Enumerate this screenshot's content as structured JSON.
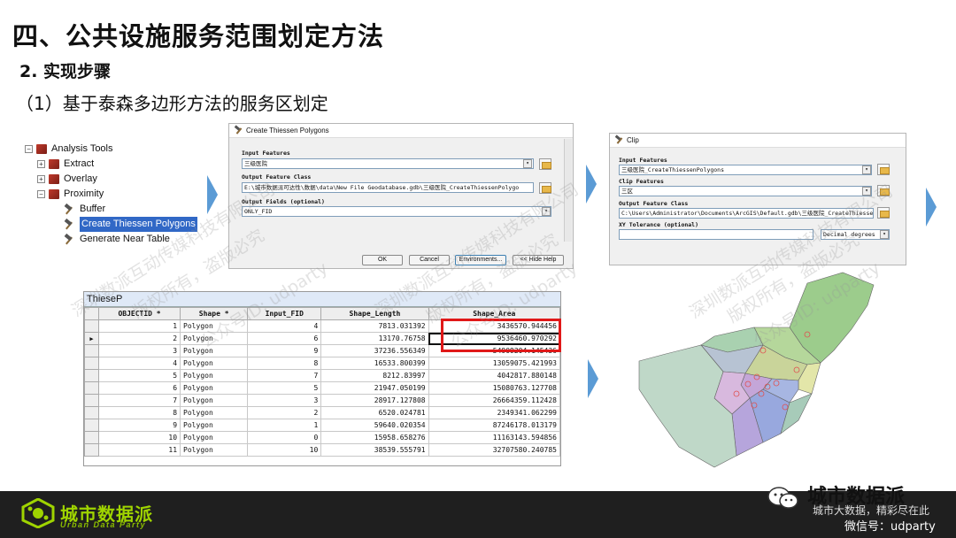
{
  "slide": {
    "title": "四、公共设施服务范围划定方法",
    "subtitle": "2. 实现步骤",
    "step": "（1）基于泰森多边形方法的服务区划定"
  },
  "toolbox": {
    "root": "Analysis Tools",
    "items": [
      "Extract",
      "Overlay",
      "Proximity"
    ],
    "tools": [
      "Buffer",
      "Create Thiessen Polygons",
      "Generate Near Table"
    ],
    "selected_tool": "Create Thiessen Polygons"
  },
  "thiessen_dialog": {
    "title": "Create Thiessen Polygons",
    "input_label": "Input Features",
    "input_value": "三级医院",
    "output_label": "Output Feature Class",
    "output_value": "E:\\城市数据派可达性\\数据\\data\\New File Geodatabase.gdb\\三级医院_CreateThiessenPolygo",
    "fields_label": "Output Fields (optional)",
    "fields_value": "ONLY_FID",
    "ok": "OK",
    "cancel": "Cancel",
    "environments": "Environments...",
    "hide_help": "<< Hide Help"
  },
  "clip_dialog": {
    "title": "Clip",
    "input_label": "Input Features",
    "input_value": "三级医院_CreateThiessenPolygons",
    "clip_label": "Clip Features",
    "clip_value": "三区",
    "output_label": "Output Feature Class",
    "output_value": "C:\\Users\\Administrator\\Documents\\ArcGIS\\Default.gdb\\三级医院_CreateThiessenPolygons",
    "xy_label": "XY Tolerance (optional)",
    "xy_unit": "Decimal degrees"
  },
  "attr_table": {
    "caption": "ThieseP",
    "columns": [
      "OBJECTID *",
      "Shape *",
      "Input_FID",
      "Shape_Length",
      "Shape_Area"
    ],
    "rows": [
      [
        "1",
        "Polygon",
        "4",
        "7813.031392",
        "3436570.944456"
      ],
      [
        "2",
        "Polygon",
        "6",
        "13170.76758",
        "9536460.970292"
      ],
      [
        "3",
        "Polygon",
        "9",
        "37236.556349",
        "54909204.145436"
      ],
      [
        "4",
        "Polygon",
        "8",
        "16533.800399",
        "13059075.421993"
      ],
      [
        "5",
        "Polygon",
        "7",
        "8212.83997",
        "4042817.880148"
      ],
      [
        "6",
        "Polygon",
        "5",
        "21947.050199",
        "15080763.127708"
      ],
      [
        "7",
        "Polygon",
        "3",
        "28917.127808",
        "26664359.112428"
      ],
      [
        "8",
        "Polygon",
        "2",
        "6520.024781",
        "2349341.062299"
      ],
      [
        "9",
        "Polygon",
        "1",
        "59640.020354",
        "87246178.013179"
      ],
      [
        "10",
        "Polygon",
        "0",
        "15958.658276",
        "11163143.594856"
      ],
      [
        "11",
        "Polygon",
        "10",
        "38539.555791",
        "32707580.240785"
      ]
    ],
    "current_row": 1
  },
  "watermarks": {
    "line1": "深圳数派互动传媒科技有限公司",
    "line2": "版权所有，盗版必究",
    "line3": "公众号ID: udparty"
  },
  "footer": {
    "logo_cn": "城市数据派",
    "logo_en": "Urban Data Party",
    "brand_name": "城市数据派",
    "slogan": "城市大数据，精彩尽在此",
    "wechat": "微信号：udparty"
  },
  "colors": {
    "accent_arrow": "#5b9bd5",
    "highlight": "#e01818",
    "logo_green": "#9fd400",
    "footer_bg": "#1f1f1f"
  }
}
